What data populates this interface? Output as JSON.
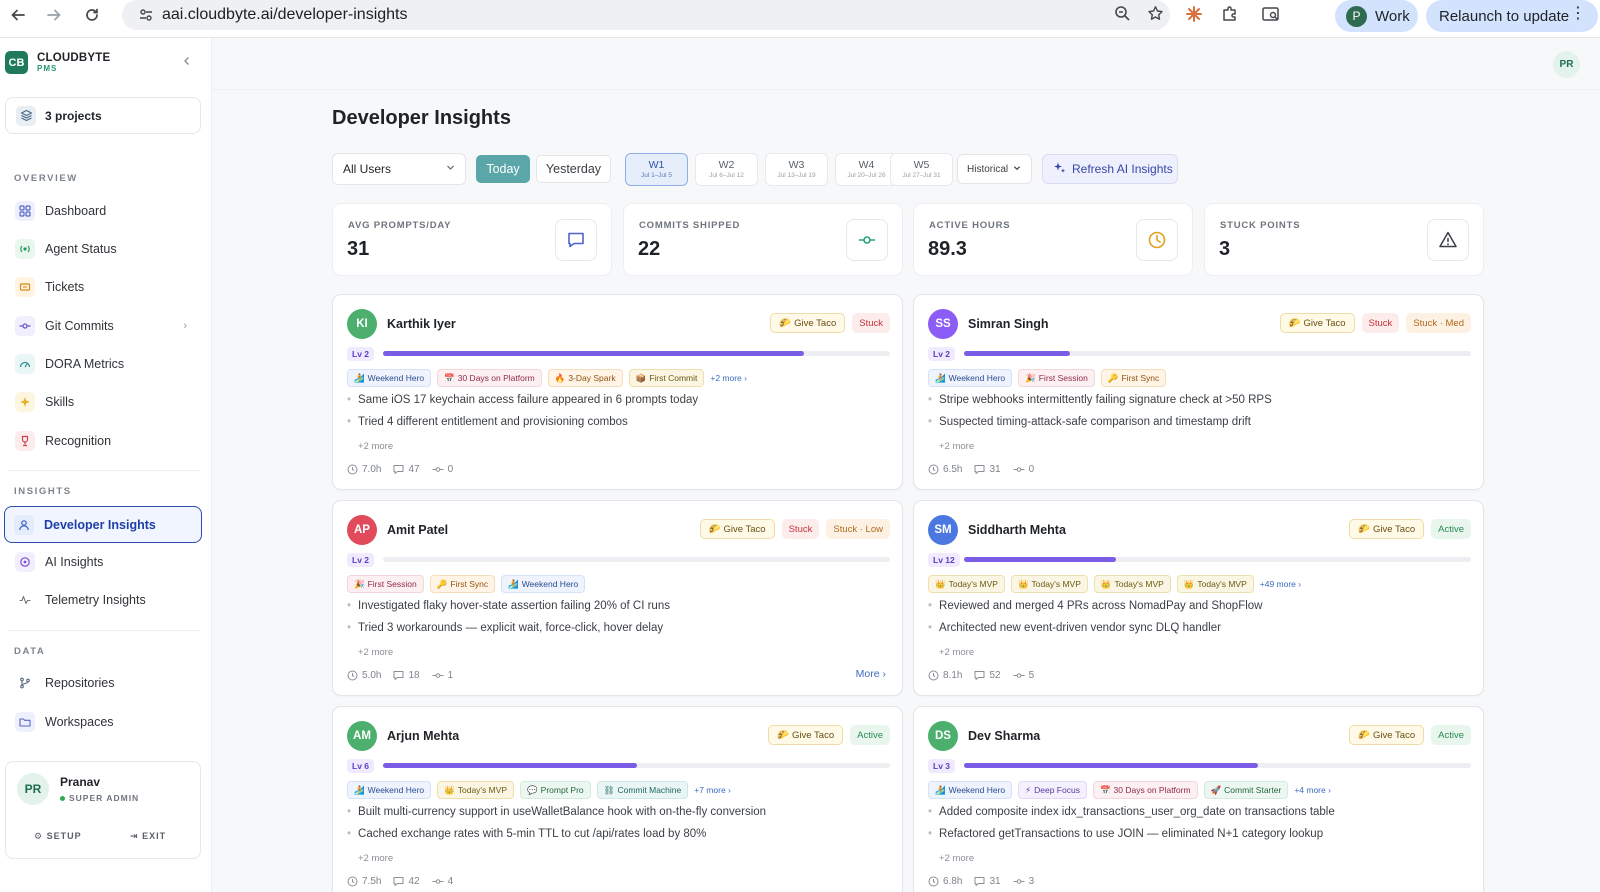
{
  "browser": {
    "url": "aai.cloudbyte.ai/developer-insights",
    "profile_initial": "P",
    "profile_label": "Work",
    "relaunch_label": "Relaunch to update"
  },
  "sidebar": {
    "brand_name": "CLOUDBYTE",
    "brand_sub": "PMS",
    "brand_logo": "CB",
    "projects_label": "3 projects",
    "sections": {
      "overview": "OVERVIEW",
      "insights": "INSIGHTS",
      "data": "DATA"
    },
    "items": [
      {
        "label": "Dashboard",
        "icon": "dashboard-icon"
      },
      {
        "label": "Agent Status",
        "icon": "agent-icon"
      },
      {
        "label": "Tickets",
        "icon": "ticket-icon"
      },
      {
        "label": "Git Commits",
        "icon": "git-commit-icon"
      },
      {
        "label": "DORA Metrics",
        "icon": "gauge-icon"
      },
      {
        "label": "Skills",
        "icon": "sparkle-icon"
      },
      {
        "label": "Recognition",
        "icon": "trophy-icon"
      },
      {
        "label": "Developer Insights",
        "icon": "users-icon"
      },
      {
        "label": "AI Insights",
        "icon": "ai-icon"
      },
      {
        "label": "Telemetry Insights",
        "icon": "pulse-icon"
      },
      {
        "label": "Repositories",
        "icon": "repo-icon"
      },
      {
        "label": "Workspaces",
        "icon": "folder-icon"
      }
    ],
    "user": {
      "initials": "PR",
      "name": "Pranav",
      "role": "SUPER ADMIN",
      "setup_label": "SETUP",
      "exit_label": "EXIT"
    }
  },
  "header": {
    "avatar_initials": "PR",
    "title": "Developer Insights"
  },
  "filters": {
    "users_select": "All Users",
    "today_label": "Today",
    "yesterday_label": "Yesterday",
    "weeks": [
      {
        "label": "W1",
        "dates": "Jul 1–Jul 5"
      },
      {
        "label": "W2",
        "dates": "Jul 6–Jul 12"
      },
      {
        "label": "W3",
        "dates": "Jul 13–Jul 19"
      },
      {
        "label": "W4",
        "dates": "Jul 20–Jul 26"
      },
      {
        "label": "W5",
        "dates": "Jul 27–Jul 31"
      }
    ],
    "historical_label": "Historical",
    "refresh_label": "Refresh AI Insights"
  },
  "stats": [
    {
      "label": "AVG PROMPTS/DAY",
      "value": "31",
      "icon": "chat-icon"
    },
    {
      "label": "COMMITS SHIPPED",
      "value": "22",
      "icon": "commit-icon"
    },
    {
      "label": "ACTIVE HOURS",
      "value": "89.3",
      "icon": "clock-icon"
    },
    {
      "label": "STUCK POINTS",
      "value": "3",
      "icon": "warning-icon"
    }
  ],
  "developers": [
    {
      "initials": "KI",
      "name": "Karthik Iyer",
      "avatar_color": "#4caf6e",
      "taco_label": "Give Taco",
      "status": "Stuck",
      "severity": "",
      "level": "Lv 2",
      "progress": 0.83,
      "achievements": [
        {
          "label": "Weekend Hero",
          "emoji": "🏄",
          "tone": "c-blue"
        },
        {
          "label": "30 Days on Platform",
          "emoji": "📅",
          "tone": "c-pink"
        },
        {
          "label": "3-Day Spark",
          "emoji": "🔥",
          "tone": "c-orange"
        },
        {
          "label": "First Commit",
          "emoji": "📦",
          "tone": "c-amber"
        }
      ],
      "more_achievements": "+2 more",
      "bullets": [
        "Same iOS 17 keychain access failure appeared in 6 prompts today",
        "Tried 4 different entitlement and provisioning combos"
      ],
      "bullets_more": "+2 more",
      "hours": "7.0h",
      "prompts": "47",
      "commits": "0",
      "more_btn": ""
    },
    {
      "initials": "SS",
      "name": "Simran Singh",
      "avatar_color": "#8b5cf6",
      "taco_label": "Give Taco",
      "status": "Stuck",
      "severity": "Stuck · Med",
      "level": "Lv 2",
      "progress": 0.21,
      "achievements": [
        {
          "label": "Weekend Hero",
          "emoji": "🏄",
          "tone": "c-blue"
        },
        {
          "label": "First Session",
          "emoji": "🎉",
          "tone": "c-pink"
        },
        {
          "label": "First Sync",
          "emoji": "🔑",
          "tone": "c-orange"
        }
      ],
      "more_achievements": "",
      "bullets": [
        "Stripe webhooks intermittently failing signature check at >50 RPS",
        "Suspected timing-attack-safe comparison and timestamp drift"
      ],
      "bullets_more": "+2 more",
      "hours": "6.5h",
      "prompts": "31",
      "commits": "0",
      "more_btn": ""
    },
    {
      "initials": "AP",
      "name": "Amit Patel",
      "avatar_color": "#e04a5a",
      "taco_label": "Give Taco",
      "status": "Stuck",
      "severity": "Stuck · Low",
      "level": "Lv 2",
      "progress": 0.0,
      "achievements": [
        {
          "label": "First Session",
          "emoji": "🎉",
          "tone": "c-pink"
        },
        {
          "label": "First Sync",
          "emoji": "🔑",
          "tone": "c-orange"
        },
        {
          "label": "Weekend Hero",
          "emoji": "🏄",
          "tone": "c-blue"
        }
      ],
      "more_achievements": "",
      "bullets": [
        "Investigated flaky hover-state assertion failing 20% of CI runs",
        "Tried 3 workarounds — explicit wait, force-click, hover delay"
      ],
      "bullets_more": "+2 more",
      "hours": "5.0h",
      "prompts": "18",
      "commits": "1",
      "more_btn": "More"
    },
    {
      "initials": "SM",
      "name": "Siddharth Mehta",
      "avatar_color": "#4a78e0",
      "taco_label": "Give Taco",
      "status": "Active",
      "severity": "",
      "level": "Lv 12",
      "progress": 0.3,
      "achievements": [
        {
          "label": "Today's MVP",
          "emoji": "👑",
          "tone": "c-amber"
        },
        {
          "label": "Today's MVP",
          "emoji": "👑",
          "tone": "c-amber"
        },
        {
          "label": "Today's MVP",
          "emoji": "👑",
          "tone": "c-amber"
        },
        {
          "label": "Today's MVP",
          "emoji": "👑",
          "tone": "c-amber"
        }
      ],
      "more_achievements": "+49 more",
      "bullets": [
        "Reviewed and merged 4 PRs across NomadPay and ShopFlow",
        "Architected new event-driven vendor sync DLQ handler"
      ],
      "bullets_more": "+2 more",
      "hours": "8.1h",
      "prompts": "52",
      "commits": "5",
      "more_btn": ""
    },
    {
      "initials": "AM",
      "name": "Arjun Mehta",
      "avatar_color": "#4caf6e",
      "taco_label": "Give Taco",
      "status": "Active",
      "severity": "",
      "level": "Lv 6",
      "progress": 0.5,
      "achievements": [
        {
          "label": "Weekend Hero",
          "emoji": "🏄",
          "tone": "c-blue"
        },
        {
          "label": "Today's MVP",
          "emoji": "👑",
          "tone": "c-amber"
        },
        {
          "label": "Prompt Pro",
          "emoji": "💬",
          "tone": "c-green"
        },
        {
          "label": "Commit Machine",
          "emoji": "⛓",
          "tone": "c-teal"
        }
      ],
      "more_achievements": "+7 more",
      "bullets": [
        "Built multi-currency support in useWalletBalance hook with on-the-fly conversion",
        "Cached exchange rates with 5-min TTL to cut /api/rates load by 80%"
      ],
      "bullets_more": "+2 more",
      "hours": "7.5h",
      "prompts": "42",
      "commits": "4",
      "more_btn": ""
    },
    {
      "initials": "DS",
      "name": "Dev Sharma",
      "avatar_color": "#4caf6e",
      "taco_label": "Give Taco",
      "status": "Active",
      "severity": "",
      "level": "Lv 3",
      "progress": 0.58,
      "achievements": [
        {
          "label": "Weekend Hero",
          "emoji": "🏄",
          "tone": "c-blue"
        },
        {
          "label": "Deep Focus",
          "emoji": "⚡",
          "tone": "c-purple"
        },
        {
          "label": "30 Days on Platform",
          "emoji": "📅",
          "tone": "c-pink"
        },
        {
          "label": "Commit Starter",
          "emoji": "🚀",
          "tone": "c-green"
        }
      ],
      "more_achievements": "+4 more",
      "bullets": [
        "Added composite index idx_transactions_user_org_date on transactions table",
        "Refactored getTransactions to use JOIN — eliminated N+1 category lookup"
      ],
      "bullets_more": "+2 more",
      "hours": "6.8h",
      "prompts": "31",
      "commits": "3",
      "more_btn": ""
    }
  ]
}
